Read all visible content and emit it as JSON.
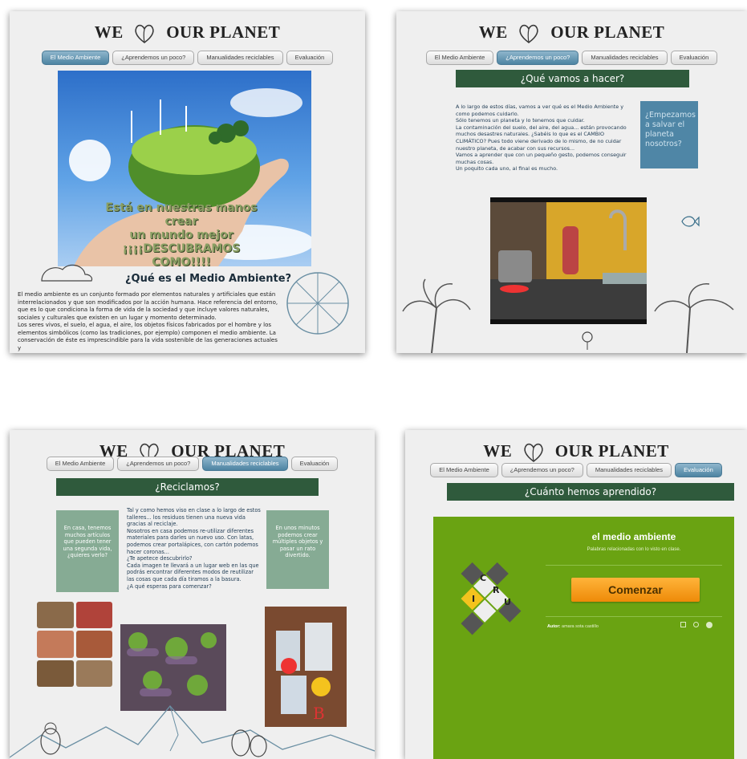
{
  "site": {
    "logo_left": "WE",
    "logo_right": "OUR PLANET"
  },
  "nav": {
    "tabs": [
      "El Medio Ambiente",
      "¿Aprendemos un poco?",
      "Manualidades reciclables",
      "Evaluación"
    ]
  },
  "panel1": {
    "hero_caption_1": "Está en nuestras manos crear",
    "hero_caption_2": "un mundo mejor",
    "hero_caption_3": "¡¡¡¡DESCUBRAMOS COMO!!!!",
    "heading": "¿Qué es el Medio Ambiente?",
    "paragraph_1": "El medio ambiente es un conjunto formado por elementos naturales y artificiales que están interrelacionados y que son modificados por la acción humana. Hace referencia del entorno, que es lo que condiciona la forma de vida de la sociedad y que incluye valores naturales, sociales y culturales que existen en un lugar y momento determinado.",
    "paragraph_2": "Los seres vivos, el suelo, el agua, el aire, los objetos físicos fabricados por el hombre y los elementos simbólicos (como las tradiciones, por ejemplo) componen el medio ambiente. La conservación de éste es imprescindible para la vida sostenible de las generaciones actuales y"
  },
  "panel2": {
    "title": "¿Qué vamos a hacer?",
    "lines": [
      "A lo largo de estos días, vamos a ver qué es el Medio Ambiente y como podemos cuidarlo.",
      "Sólo tenemos un planeta y lo tenemos que cuidar.",
      "La contaminación del suelo, del aire, del agua... están provocando muchos desastres naturales. ¿Sabéis lo que es el CAMBIO CLIMÁTICO? Pues todo viene derivado de lo mismo, de no cuidar nuestro planeta, de acabar con sus recursos...",
      "Vamos a aprender que con un pequeño gesto, podemos conseguir muchas cosas.",
      "Un poquito cada uno, al final es mucho."
    ],
    "side_box": "¿Empezamos a salvar el planeta nosotros?"
  },
  "panel3": {
    "title": "¿Reciclamos?",
    "left_box": "En casa, tenemos muchos artículos que pueden tener una segunda vida, ¿quieres verlo?",
    "right_box": "En unos minutos podemos crear múltiples objetos y pasar un rato divertido.",
    "lines": [
      "Tal y como hemos viso en clase a lo largo de estos talleres... los residuos tienen una nueva vida gracias al reciclaje.",
      "Nosotros en casa podemos re-utilizar diferentes materiales para darles un nuevo uso. Con latas, podemos crear portalápices, con cartón podemos hacer coronas...",
      "¿Te apetece descubrirlo?",
      "Cada imagen te llevará a un lugar web en las que podrás encontrar diferentes modos de reutilizar las cosas que cada día tiramos a la basura.",
      "¿A qué esperas para comenzar?"
    ]
  },
  "panel4": {
    "title": "¿Cuánto hemos aprendido?",
    "quiz_title": "el medio ambiente",
    "quiz_subtitle": "Palabras relacionadas con lo visto en clase.",
    "start_button": "Comenzar",
    "author_label": "Autor:",
    "author_name": "amara sota castillo",
    "cube_letters": [
      "C",
      "R",
      "U",
      "I"
    ]
  },
  "colors": {
    "green_bar": "#2f5a3c",
    "quiz_green": "#6aa312",
    "button_orange": "#f39a12",
    "active_tab": "#5d8fad",
    "box_blue": "#4f86a6",
    "box_green": "#86ab94"
  }
}
